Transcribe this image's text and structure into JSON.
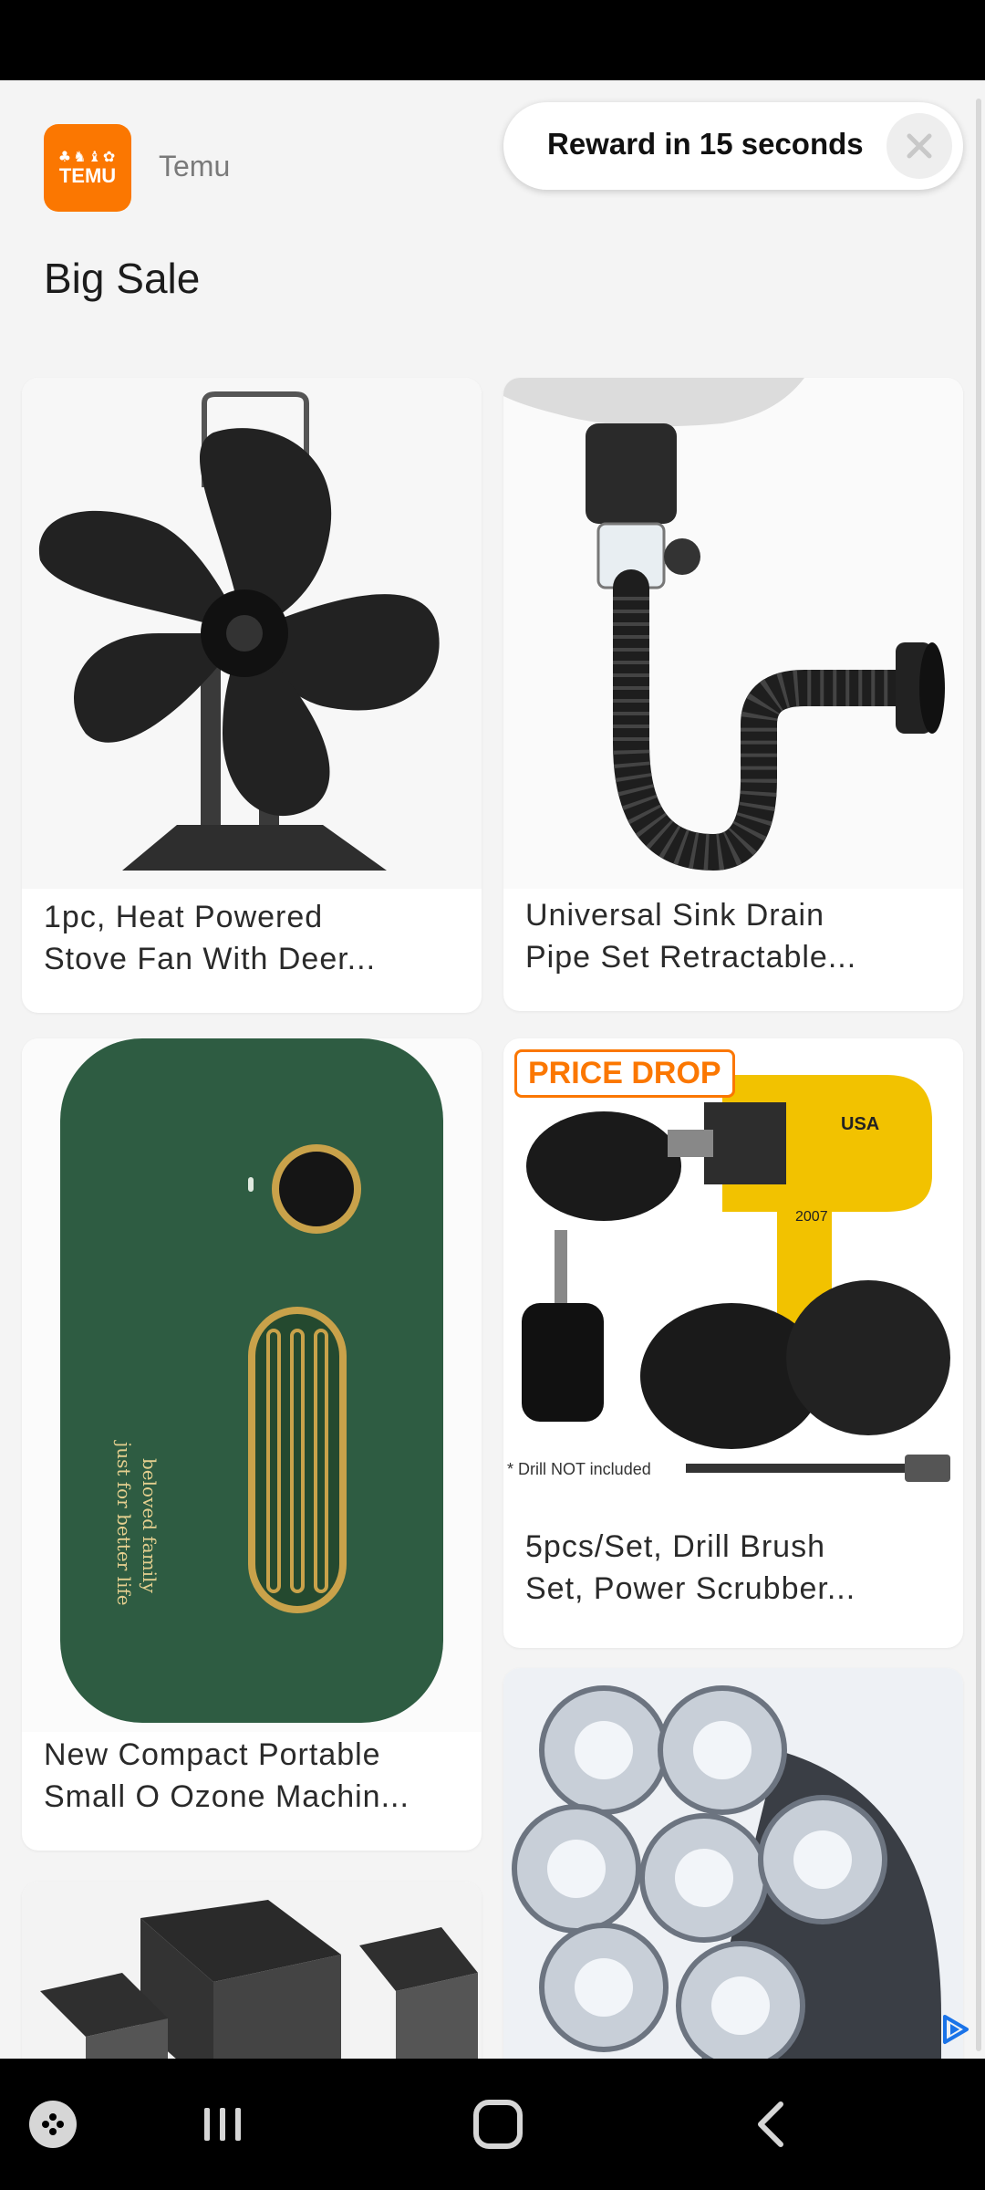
{
  "ad": {
    "advertiser": "Temu",
    "logo_glyphs": "♣♞♝✿",
    "logo_word": "TEMU",
    "headline": "Big Sale",
    "reward_text": "Reward in 15 seconds"
  },
  "products": [
    {
      "title_line1": "1pc, Heat Powered",
      "title_line2": "Stove Fan With Deer..."
    },
    {
      "title_line1": "Universal Sink Drain",
      "title_line2": "Pipe Set Retractable..."
    },
    {
      "title_line1": "New Compact Portable",
      "title_line2": "Small O Ozone Machin..."
    },
    {
      "title_line1": "5pcs/Set, Drill Brush",
      "title_line2": "Set, Power Scrubber...",
      "badge": "PRICE DROP",
      "note": "* Drill NOT included"
    }
  ],
  "ozone_device_text": [
    "beloved family",
    "just for better life"
  ],
  "drill_text": {
    "brand": "USA",
    "year": "2007"
  },
  "colors": {
    "brand": "#fb7701",
    "ozone_green": "#2e5c42",
    "gold": "#c9a24a"
  },
  "icons": [
    "close-icon",
    "adchoices-icon",
    "game-launcher-icon",
    "recent-apps-icon",
    "home-icon",
    "back-icon"
  ]
}
